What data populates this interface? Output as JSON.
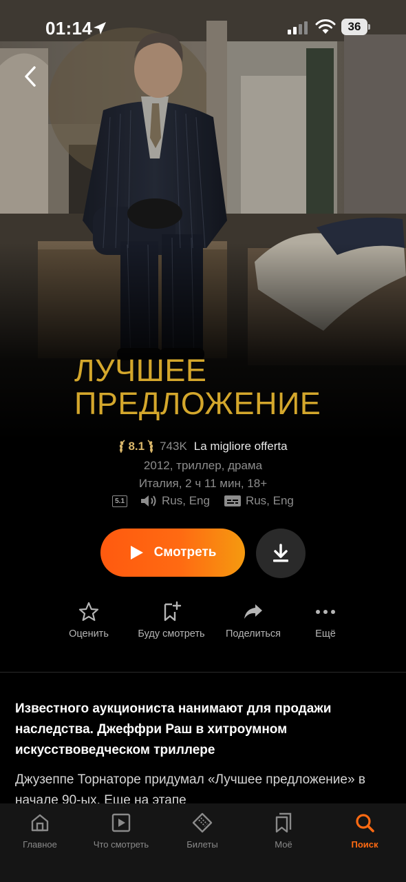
{
  "status_bar": {
    "time": "01:14",
    "battery": "36"
  },
  "movie": {
    "title": "Лучшее предложение",
    "rating": "8.1",
    "votes": "743K",
    "original_title": "La migliore offerta",
    "year_genres": "2012, триллер, драма",
    "country_duration_age": "Италия, 2 ч 11 мин, 18+",
    "sound_badge": "5.1",
    "audio": "Rus, Eng",
    "subtitles": "Rus, Eng"
  },
  "buttons": {
    "watch": "Смотреть"
  },
  "actions": [
    {
      "label": "Оценить",
      "icon": "star-icon"
    },
    {
      "label": "Буду смотреть",
      "icon": "bookmark-plus-icon"
    },
    {
      "label": "Поделиться",
      "icon": "share-icon"
    },
    {
      "label": "Ещё",
      "icon": "more-icon"
    }
  ],
  "description": {
    "headline": "Известного аукциониста нанимают для продажи наследства. Джеффри Раш в хитроумном искусствоведческом триллере",
    "body": "Джузеппе Торнаторе придумал «Лучшее предложение» в начале 90-ых. Еще на этапе"
  },
  "tabbar": [
    {
      "label": "Главное",
      "icon": "home-icon",
      "active": false
    },
    {
      "label": "Что смотреть",
      "icon": "play-square-icon",
      "active": false
    },
    {
      "label": "Билеты",
      "icon": "ticket-icon",
      "active": false
    },
    {
      "label": "Моё",
      "icon": "bookmarks-icon",
      "active": false
    },
    {
      "label": "Поиск",
      "icon": "search-icon",
      "active": true
    }
  ],
  "colors": {
    "accent": "#ff6a12",
    "title_gold": "#d4a72c",
    "rating_gold": "#d9b66a"
  }
}
